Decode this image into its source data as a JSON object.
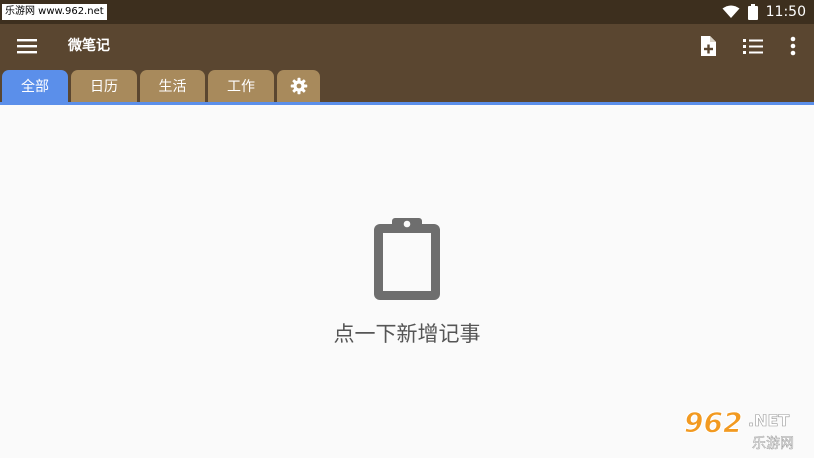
{
  "statusbar": {
    "watermark_text": "乐游网 www.962.net",
    "time": "11:50"
  },
  "toolbar": {
    "title": "微笔记",
    "icons": [
      "menu-icon",
      "new-note-icon",
      "list-view-icon",
      "more-vert-icon"
    ]
  },
  "tabs": [
    {
      "label": "全部",
      "active": true
    },
    {
      "label": "日历",
      "active": false
    },
    {
      "label": "生活",
      "active": false
    },
    {
      "label": "工作",
      "active": false
    },
    {
      "label": "",
      "icon": "gear-icon",
      "active": false
    }
  ],
  "empty_state": {
    "icon": "clipboard-icon",
    "message": "点一下新增记事"
  },
  "watermark_logo": {
    "number": "962",
    "suffix": ".NET",
    "name": "乐游网"
  },
  "colors": {
    "statusbar": "#3d2f1e",
    "toolbar": "#5a4630",
    "tab": "#a88a5c",
    "tab_active": "#5b8fea",
    "background": "#fafafa",
    "empty_icon": "#6e6e6e"
  }
}
